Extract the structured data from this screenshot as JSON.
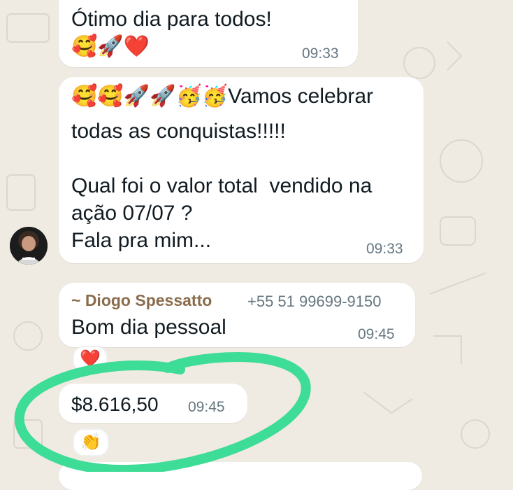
{
  "colors": {
    "background": "#efeae2",
    "bubble": "#ffffff",
    "sender_name": "#8a6c4c",
    "timestamp": "#667781",
    "highlight_circle": "#3ddc97"
  },
  "messages": [
    {
      "text": "Ótimo dia para todos!",
      "emojis": [
        "🥰",
        "🚀",
        "❤️"
      ],
      "time": "09:33"
    },
    {
      "emojis": [
        "🥰",
        "🥰",
        "🚀",
        "🚀",
        "🥳",
        "🥳"
      ],
      "text_line1": "Vamos celebrar",
      "text_rest": "todas as conquistas!!!!!\n\nQual foi o valor total  vendido na\nação 07/07 ?\nFala pra mim...",
      "time": "09:33",
      "avatar_icon": "profile-photo"
    },
    {
      "sender_name": "~ Diogo Spessatto",
      "sender_phone": "+55 51 99699-9150",
      "text": "Bom dia pessoal",
      "time": "09:45",
      "reaction": "❤️"
    },
    {
      "text": "$8.616,50",
      "time": "09:45",
      "reaction": "👏"
    }
  ]
}
